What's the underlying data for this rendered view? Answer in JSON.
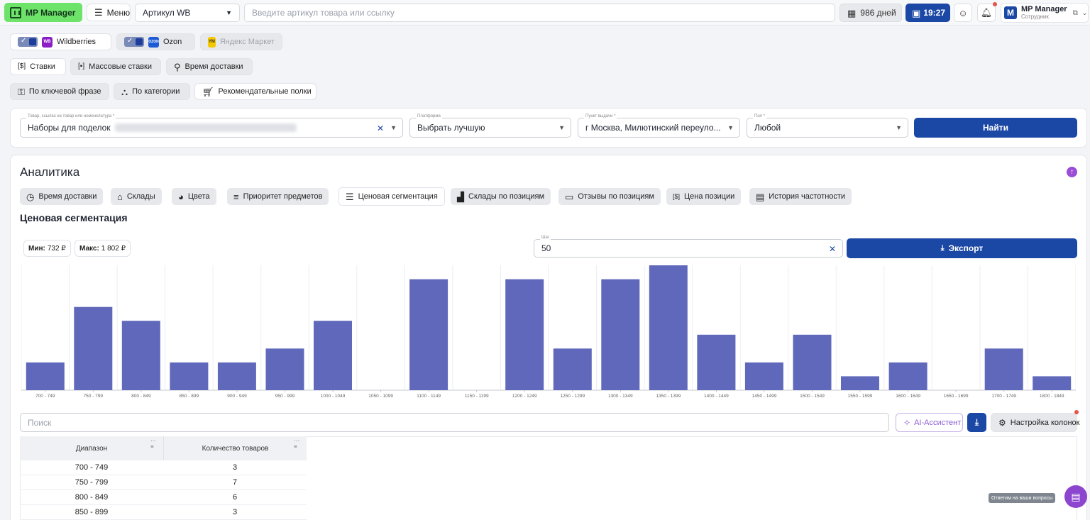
{
  "topbar": {
    "logo": "MP Manager",
    "menu": "Меню",
    "article_select": "Артикул WB",
    "search_placeholder": "Введите артикул товара или ссылку",
    "days": "986 дней",
    "time": "19:27",
    "user_name": "MP Manager",
    "user_role": "Сотрудник"
  },
  "marketplaces": [
    {
      "label": "Wildberries",
      "badge": "WB",
      "color": "#8b1ec4",
      "enabled": true
    },
    {
      "label": "Ozon",
      "badge": "OZON",
      "color": "#1d5bd6",
      "enabled": true
    },
    {
      "label": "Яндекс Маркет",
      "badge": "YM",
      "color": "#f5c800",
      "enabled": false
    }
  ],
  "modes": {
    "row1": [
      "Ставки",
      "Массовые ставки",
      "Время доставки"
    ],
    "row2": [
      "По ключевой фразе",
      "По категории",
      "Рекомендательные полки"
    ]
  },
  "filters": {
    "product_label": "Товар, ссылка на товар или номенклатура *",
    "product_value": "Наборы для поделок",
    "platform_label": "Платформа",
    "platform_value": "Выбрать лучшую",
    "pickup_label": "Пункт выдачи *",
    "pickup_value": "г Москва, Милютинский переуло...",
    "gender_label": "Пол *",
    "gender_value": "Любой",
    "find_button": "Найти"
  },
  "analytics": {
    "title": "Аналитика",
    "tabs": [
      "Время доставки",
      "Склады",
      "Цвета",
      "Приоритет предметов",
      "Ценовая сегментация",
      "Склады по позициям",
      "Отзывы по позициям",
      "Цена позиции",
      "История частотности"
    ],
    "active_tab": "Ценовая сегментация",
    "section_title": "Ценовая сегментация",
    "min_label": "Мин:",
    "min_value": "732 ₽",
    "max_label": "Макс:",
    "max_value": "1 802 ₽",
    "step_label": "Шаг",
    "step_value": "50",
    "export_button": "Экспорт"
  },
  "chart_data": {
    "type": "bar",
    "categories": [
      "700 - 749",
      "750 - 799",
      "800 - 849",
      "850 - 899",
      "900 - 949",
      "950 - 999",
      "1000 - 1049",
      "1050 - 1099",
      "1100 - 1149",
      "1150 - 1199",
      "1200 - 1249",
      "1250 - 1299",
      "1300 - 1349",
      "1350 - 1399",
      "1400 - 1449",
      "1450 - 1499",
      "1500 - 1549",
      "1550 - 1599",
      "1600 - 1649",
      "1650 - 1699",
      "1700 - 1749",
      "1800 - 1849"
    ],
    "values": [
      2,
      6,
      5,
      2,
      2,
      3,
      5,
      0,
      8,
      0,
      8,
      3,
      8,
      9,
      4,
      2,
      4,
      1,
      2,
      0,
      3,
      1
    ],
    "ylim": [
      0,
      9
    ],
    "color": "#6068bb",
    "grid": true
  },
  "table_tools": {
    "search_placeholder": "Поиск",
    "ai_button": "AI-Ассистент",
    "columns_button": "Настройка колонок"
  },
  "table": {
    "headers": [
      "Диапазон",
      "Количество товаров"
    ],
    "rows": [
      [
        "700 - 749",
        "3"
      ],
      [
        "750 - 799",
        "7"
      ],
      [
        "800 - 849",
        "6"
      ],
      [
        "850 - 899",
        "3"
      ]
    ]
  },
  "support": {
    "tooltip": "Ответим на ваши вопросы"
  }
}
